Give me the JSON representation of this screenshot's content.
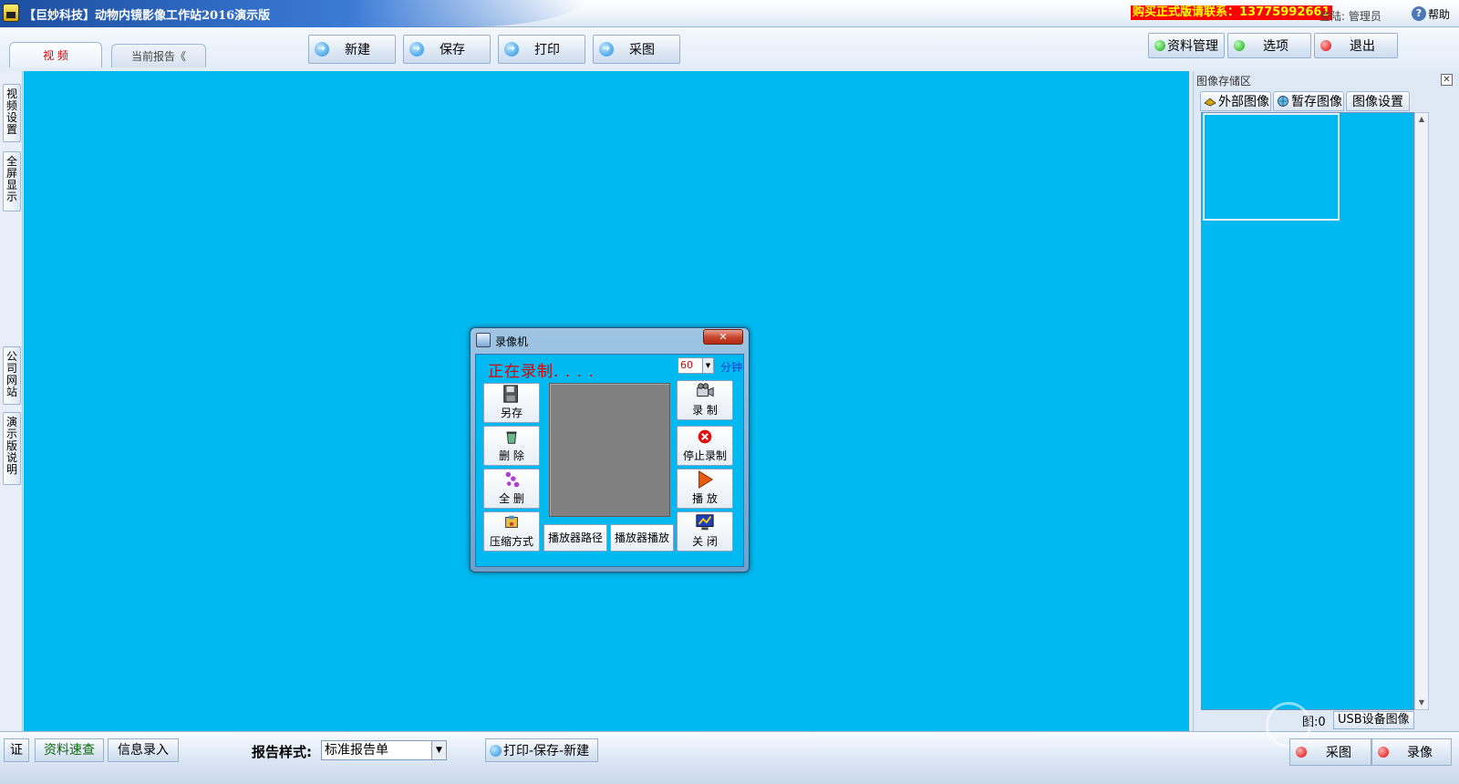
{
  "title_bar": {
    "app_title": "【巨妙科技】动物内镜影像工作站2016演示版",
    "promo": "购买正式版请联系：13775992661",
    "login_label": "登陆: 管理员",
    "help_label": "帮助"
  },
  "tabs": [
    {
      "label": "视 频",
      "active": true
    },
    {
      "label": "当前报告《",
      "active": false
    }
  ],
  "toolbar": {
    "new_label": "新建",
    "save_label": "保存",
    "print_label": "打印",
    "capture_label": "采图"
  },
  "right_toolbar": {
    "data_mgmt_label": "资料管理",
    "options_label": "选项",
    "exit_label": "退出"
  },
  "left_tabs": [
    {
      "label": "视频设置"
    },
    {
      "label": "全屏显示"
    },
    {
      "label": "公司网站"
    },
    {
      "label": "演示版说明"
    }
  ],
  "image_panel": {
    "title": "图像存储区",
    "close_glyph": "✕",
    "tabs": [
      "外部图像",
      "暂存图像",
      "图像设置"
    ],
    "count_label": "图:0",
    "usb_button": "USB设备图像"
  },
  "recorder_dialog": {
    "title": "录像机",
    "close_glyph": "✕",
    "status_text": "正在录制. . . .",
    "duration_value": "60",
    "duration_unit": "分钟",
    "buttons": {
      "save_as": "另存",
      "delete": "删 除",
      "delete_all": "全 删",
      "compress": "压缩方式",
      "record": "录 制",
      "stop": "停止录制",
      "play": "播 放",
      "close": "关 闭",
      "player_path": "播放器路径",
      "player_play": "播放器播放"
    }
  },
  "status_bar": {
    "cert_label": "证",
    "quick_lookup_label": "资料速查",
    "info_entry_label": "信息录入",
    "report_style_label": "报告样式:",
    "report_style_value": "标准报告单",
    "print_save_new_label": "打印-保存-新建",
    "capture_label": "采图",
    "record_label": "录像"
  },
  "colors": {
    "video_bg": "#00b9f0",
    "title_blue": "#1c4ea0",
    "promo_bg": "#ff0000",
    "promo_fg": "#ffff00",
    "recording_red": "#e00000",
    "preview_gray": "#808080"
  }
}
